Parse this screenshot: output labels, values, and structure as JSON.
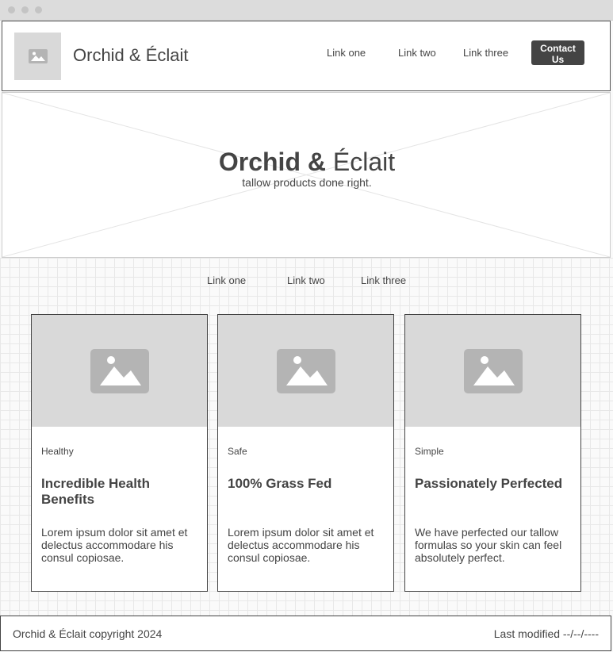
{
  "header": {
    "site_title": "Orchid & Éclait",
    "nav": [
      "Link one",
      "Link two",
      "Link three"
    ],
    "contact_label": "Contact Us"
  },
  "hero": {
    "title_bold": "Orchid &",
    "title_light": " Éclait",
    "subtitle": "tallow products done right."
  },
  "subnav": [
    "Link one",
    "Link two",
    "Link three"
  ],
  "cards": [
    {
      "tag": "Healthy",
      "title": "Incredible Health Benefits",
      "body": "Lorem ipsum dolor sit amet et delectus accommodare his consul copiosae."
    },
    {
      "tag": "Safe",
      "title": "100% Grass Fed",
      "body": "Lorem ipsum dolor sit amet et delectus accommodare his consul copiosae."
    },
    {
      "tag": "Simple",
      "title": "Passionately Perfected",
      "body": "We have perfected our tallow formulas so your skin can feel absolutely perfect."
    }
  ],
  "footer": {
    "copyright": "Orchid & Éclait copyright 2024",
    "last_modified": "Last modified --/--/----"
  },
  "icons": {
    "logo": "image-placeholder-icon",
    "card_image": "image-placeholder-icon"
  },
  "colors": {
    "text": "#444444",
    "button": "#444444",
    "placeholder": "#d9d9d9",
    "placeholder_icon": "#b4b4b4"
  }
}
